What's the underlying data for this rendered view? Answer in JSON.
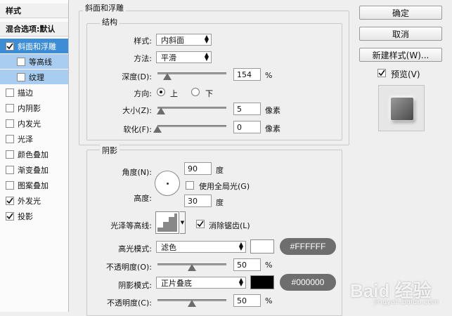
{
  "styles_panel": {
    "header": "样式",
    "blend_options": "混合选项:默认",
    "items": [
      {
        "label": "斜面和浮雕",
        "checked": true,
        "state": "active"
      },
      {
        "label": "等高线",
        "checked": false,
        "state": "sub"
      },
      {
        "label": "纹理",
        "checked": false,
        "state": "sub"
      },
      {
        "label": "描边",
        "checked": false
      },
      {
        "label": "内阴影",
        "checked": false
      },
      {
        "label": "内发光",
        "checked": false
      },
      {
        "label": "光泽",
        "checked": false
      },
      {
        "label": "颜色叠加",
        "checked": false
      },
      {
        "label": "渐变叠加",
        "checked": false
      },
      {
        "label": "图案叠加",
        "checked": false
      },
      {
        "label": "外发光",
        "checked": true
      },
      {
        "label": "投影",
        "checked": true
      }
    ]
  },
  "bevel": {
    "title": "斜面和浮雕",
    "structure_title": "结构",
    "style_label": "样式:",
    "style_value": "内斜面",
    "technique_label": "方法:",
    "technique_value": "平滑",
    "depth_label": "深度(D):",
    "depth_value": "154",
    "depth_unit": "%",
    "direction_label": "方向:",
    "direction_up": "上",
    "direction_down": "下",
    "size_label": "大小(Z):",
    "size_value": "5",
    "size_unit": "像素",
    "soften_label": "软化(F):",
    "soften_value": "0",
    "soften_unit": "像素"
  },
  "shading": {
    "title": "阴影",
    "angle_label": "角度(N):",
    "angle_value": "90",
    "angle_unit": "度",
    "global_light_label": "使用全局光(G)",
    "altitude_label": "高度:",
    "altitude_value": "30",
    "altitude_unit": "度",
    "gloss_label": "光泽等高线:",
    "antialias_label": "消除锯齿(L)",
    "highlight_mode_label": "高光模式:",
    "highlight_mode_value": "滤色",
    "highlight_color": "#FFFFFF",
    "highlight_hex": "#FFFFFF",
    "opacity_label": "不透明度(O):",
    "highlight_opacity": "50",
    "opacity_unit": "%",
    "shadow_mode_label": "阴影模式:",
    "shadow_mode_value": "正片叠底",
    "shadow_color": "#000000",
    "shadow_hex": "#000000",
    "shadow_opacity_label": "不透明度(C):",
    "shadow_opacity": "50"
  },
  "buttons": {
    "ok": "确定",
    "cancel": "取消",
    "new_style": "新建样式(W)...",
    "preview": "预览(V)"
  },
  "watermark": {
    "text": "Baid 经验",
    "url": "jingyan.baidu.com"
  }
}
